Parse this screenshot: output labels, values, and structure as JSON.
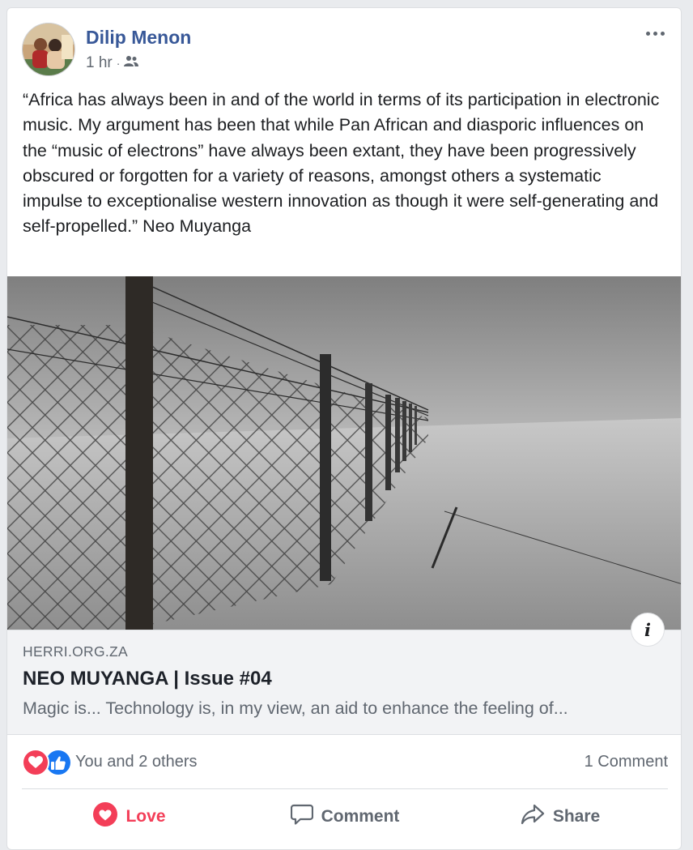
{
  "post": {
    "author": "Dilip Menon",
    "time": "1 hr",
    "separator": "·",
    "audience_icon": "friends-icon",
    "text": "“Africa has always been in and of the world in terms of its participation in electronic music. My argument has been that while Pan African and diasporic influences on the “music of electrons” have always been extant, they have been progressively obscured or forgotten for a variety of reasons, amongst others a systematic impulse to exceptionalise western innovation as though it were self-generating and self-propelled.” Neo Muyanga"
  },
  "link": {
    "domain": "HERRI.ORG.ZA",
    "title": "NEO MUYANGA | Issue #04",
    "description": "Magic is... Technology is, in my view, an aid to enhance the feeling of...",
    "info_label": "i"
  },
  "reactions": {
    "icons": [
      "love-reaction-icon",
      "like-reaction-icon"
    ],
    "text": "You and 2 others",
    "comments": "1 Comment"
  },
  "actions": {
    "love": "Love",
    "comment": "Comment",
    "share": "Share"
  },
  "colors": {
    "author_link": "#385898",
    "love": "#f33e58",
    "like": "#1877f2",
    "secondary_text": "#606770"
  }
}
